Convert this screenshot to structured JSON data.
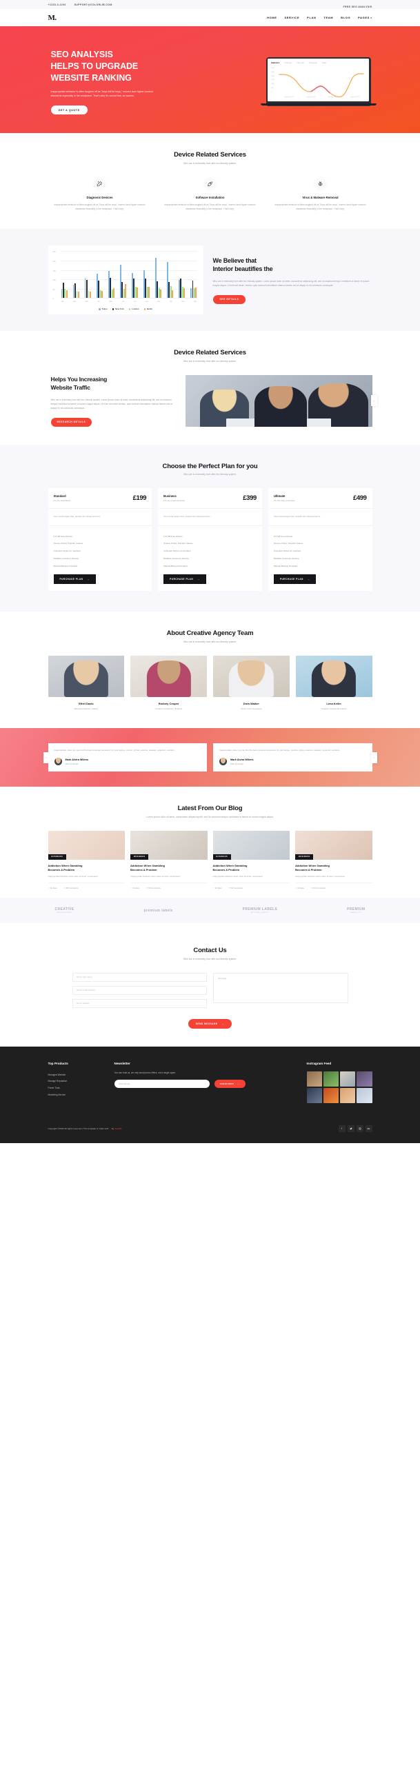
{
  "topbar": {
    "phone": "+1233-3-1203",
    "email": "SUPPORT@COLORLIB.COM",
    "cta": "FREE SEO ANALYSIS"
  },
  "nav": {
    "logo": "M.",
    "items": [
      {
        "label": "HOME"
      },
      {
        "label": "SERVICE"
      },
      {
        "label": "PLAN"
      },
      {
        "label": "TEAM"
      },
      {
        "label": "BLOG"
      },
      {
        "label": "PAGES",
        "caret": "▾"
      }
    ]
  },
  "hero": {
    "title_line1": "SEO ANALYSIS",
    "title_line2": "HELPS TO UPGRADE",
    "title_line3": "WEBSITE RANKING",
    "paragraph": "Inappropriate behavior is often laughed off as \"boys will be boys,\" women face higher conduct standards especially in the workplace. That's why it's crucial that, as women.",
    "button": "GET A QUOTE",
    "gradient_from": "#f7444e",
    "gradient_to": "#f3531f",
    "laptop": {
      "title": "Statistics",
      "tabs": [
        "Overview",
        "This year",
        "This week",
        "Today"
      ],
      "menu_icon": "kebab-menu-icon",
      "y_ticks": [
        "3000",
        "2500",
        "2000",
        "1500",
        "1000",
        "500",
        "0"
      ],
      "x_ticks": [
        "January 2019",
        "January 2019",
        "January 2019",
        "January 2019"
      ]
    }
  },
  "services": {
    "title": "Device Related Services",
    "subtitle": "Who are in extremely love with eco friendly system.",
    "items": [
      {
        "icon": "magic-wand-icon",
        "glyph": "✨",
        "title": "Diagnosis Devices",
        "text": "Inappropriate behavior is often laughed off as \"boys will be boys,\" women face higher conduct standards especially in the workplace. That's why."
      },
      {
        "icon": "rocket-icon",
        "glyph": "🚀",
        "title": "Software Installation",
        "text": "Inappropriate behavior is often laughed off as \"boys will be boys,\" women face higher conduct standards especially in the workplace. That's why."
      },
      {
        "icon": "bug-shield-icon",
        "glyph": "🛡",
        "title": "Virus & Malware Removal",
        "text": "Inappropriate behavior is often laughed off as \"boys will be boys,\" women face higher conduct standards especially in the workplace. That's why."
      }
    ]
  },
  "believe": {
    "title_line1": "We Believe that",
    "title_line2": "Interior beautifies the",
    "paragraph": "Who are in extremely love with eco friendly system. Lorem ipsum dolor sit amet, consectetur adipisicing elit, sed do eiusmod tempor incididunt ut labore et dolore magna aliqua. Ut enim ad minim veniam, quis nostrud exercitation ullamco laboris nisi ut aliquip ex ea commodo consequat.",
    "button": "SEE DETAILS"
  },
  "chart_data": {
    "type": "bar",
    "title": "",
    "xlabel": "",
    "ylabel": "",
    "ylim": [
      0,
      250
    ],
    "y_ticks": [
      0,
      50,
      100,
      150,
      200,
      250
    ],
    "grid": true,
    "legend_position": "bottom",
    "categories": [
      "Jan",
      "Feb",
      "Mar",
      "Apr",
      "May",
      "Jun",
      "Jul",
      "Aug",
      "Sep",
      "Oct",
      "Nov",
      "Dec"
    ],
    "series": [
      {
        "name": "Tokyo",
        "color": "#7cb5ec",
        "values": [
          49,
          71,
          106,
          129,
          144,
          176,
          135,
          148,
          216,
          194,
          95,
          54
        ]
      },
      {
        "name": "New York",
        "color": "#2b2b33",
        "values": [
          83,
          78,
          98,
          93,
          106,
          84,
          105,
          104,
          91,
          84,
          105,
          93
        ]
      },
      {
        "name": "London",
        "color": "#90ed7d",
        "values": [
          48,
          38,
          39,
          41,
          47,
          48,
          59,
          59,
          52,
          65,
          59,
          52
        ]
      },
      {
        "name": "Berlin",
        "color": "#f7a35c",
        "values": [
          42,
          33,
          34,
          39,
          52,
          75,
          57,
          60,
          47,
          42,
          51,
          58
        ]
      }
    ]
  },
  "traffic": {
    "section_title": "Device Related Services",
    "section_subtitle": "Who are in extremely love with eco friendly system.",
    "title_line1": "Helps You Increasing",
    "title_line2": "Website Traffic",
    "paragraph": "Who are in extremely love with eco friendly system. Lorem ipsum dolor sit amet, consectetur adipisicing elit, sed do eiusmod tempor incididunt ut labore et dolore magna aliqua. Ut enim ad minim veniam, quis nostrud exercitation ullamco laboris nisi ut aliquip ex ea commodo consequat.",
    "button": "RESEARCH DETAILS",
    "next_arrow": "›",
    "image_alt": "team-looking-at-laptop-photo"
  },
  "pricing": {
    "title": "Choose the Perfect Plan for you",
    "subtitle": "Who are in extremely love with eco friendly system.",
    "plans": [
      {
        "name": "Standard",
        "for": "For the Individuals",
        "price": "£199",
        "desc": "Few would argue that, despite the advancements.",
        "features": [
          "2.5 GB Free Photos",
          "Secure Online Transfer Indeed",
          "Unlimited Styles for Interface",
          "Reliable Customer Service",
          "Manual Backup Provided"
        ],
        "button": "PURCHASE PLAN",
        "button_arrow": "→"
      },
      {
        "name": "Business",
        "for": "For the small Company",
        "price": "£399",
        "desc": "Few would argue that, despite the advancements.",
        "features": [
          "2.5 GB Free Photos",
          "Secure Online Transfer Indeed",
          "Unlimited Styles for Interface",
          "Reliable Customer Service",
          "Manual Backup Provided"
        ],
        "button": "PURCHASE PLAN",
        "button_arrow": "→"
      },
      {
        "name": "Ultimate",
        "for": "For the large Company",
        "price": "£499",
        "desc": "Few would argue that, despite the advancements.",
        "features": [
          "2.5 GB Free Photos",
          "Secure Online Transfer Indeed",
          "Unlimited Styles for Interface",
          "Reliable Customer Service",
          "Manual Backup Provided"
        ],
        "button": "PURCHASE PLAN",
        "button_arrow": "→"
      }
    ]
  },
  "team": {
    "title": "About Creative Agency Team",
    "subtitle": "Who are in extremely love with eco friendly system.",
    "members": [
      {
        "name": "Ethel Davis",
        "role": "Managing Director (Sales)"
      },
      {
        "name": "Rodney Cooper",
        "role": "Creative Art Director (Project)"
      },
      {
        "name": "Dora Walker",
        "role": "Senior Core Developer"
      },
      {
        "name": "Lena Keller",
        "role": "Creative Content Developer"
      }
    ]
  },
  "testimonials": {
    "prev_arrow": "‹",
    "next_arrow": "›",
    "items": [
      {
        "quote": "Inappropriate. Here you can find the best computer accessory for your laptop, monitor, printer, scanner, speaker, projector, monitors.",
        "name": "Mark Alvira Wilens",
        "role": "CEO at Google"
      },
      {
        "quote": "Inappropriate. Here you can find the best computer accessory for your laptop, monitor, printer, scanner, speaker, projector, monitors.",
        "name": "Mark Alvira Wilens",
        "role": "CEO at Google"
      }
    ]
  },
  "blog": {
    "title": "Latest From Our Blog",
    "subtitle": "Lorem ipsum dolor sit amet, consectetur adipiscing elit, sed do eiusmod tempor incididunt ut labore et dolore magna aliqua.",
    "posts": [
      {
        "tag": "BUSINESS",
        "title_line1": "Addiction When Gambling",
        "title_line2": "Becomes A Problem",
        "excerpt": "Inappropriate behavior ipsum dolor sit amet, consectetur.",
        "meta_views": "1K likes",
        "meta_comments": "50 Comments"
      },
      {
        "tag": "BUSINESS",
        "title_line1": "Addiction When Gambling",
        "title_line2": "Becomes A Problem",
        "excerpt": "Inappropriate behavior ipsum dolor sit amet, consectetur.",
        "meta_views": "1K likes",
        "meta_comments": "50 Comments"
      },
      {
        "tag": "BUSINESS",
        "title_line1": "Addiction When Gambling",
        "title_line2": "Becomes A Problem",
        "excerpt": "Inappropriate behavior ipsum dolor sit amet, consectetur.",
        "meta_views": "1K likes",
        "meta_comments": "50 Comments"
      },
      {
        "tag": "BUSINESS",
        "title_line1": "Addiction When Gambling",
        "title_line2": "Becomes A Problem",
        "excerpt": "Inappropriate behavior ipsum dolor sit amet, consectetur.",
        "meta_views": "1K likes",
        "meta_comments": "50 Comments"
      }
    ]
  },
  "brands": [
    {
      "main": "CREATIVE",
      "sub": "DESIGN STUDIO"
    },
    {
      "main": "premium labels",
      "sub": ""
    },
    {
      "main": "PREMIUM LABELS",
      "sub": "EST 1984 QUALITY"
    },
    {
      "main": "PREMIUM",
      "sub": "LABELS CO."
    }
  ],
  "contact": {
    "title": "Contact Us",
    "subtitle": "Who are in extremely love with eco friendly system.",
    "name_placeholder": "Enter your name",
    "email_placeholder": "Enter email address",
    "subject_placeholder": "Enter Subject",
    "message_placeholder": "Message",
    "button": "SEND MESSAGE",
    "button_arrow": "→"
  },
  "footer": {
    "top_products_title": "Top Products",
    "top_products": [
      "Managed Website",
      "Manage Reputation",
      "Power Tools",
      "Marketing Service"
    ],
    "newsletter_title": "Newsletter",
    "newsletter_text": "You can trust us, we only send promo offers, not a single spam.",
    "newsletter_placeholder": "Enter Email",
    "newsletter_button": "SUBSCRIBE",
    "newsletter_button_arrow": "→",
    "instagram_title": "Instragram Feed",
    "copyright_pre": "Copyright ©2023 All rights reserved | This template is made with ",
    "copyright_heart": "♡",
    "copyright_mid": " by ",
    "copyright_brand": "Colorlib",
    "social": [
      {
        "name": "facebook-icon",
        "glyph": "f"
      },
      {
        "name": "twitter-icon",
        "glyph": "🐦"
      },
      {
        "name": "dribbble-icon",
        "glyph": "◉"
      },
      {
        "name": "behance-icon",
        "glyph": "Be"
      }
    ]
  }
}
